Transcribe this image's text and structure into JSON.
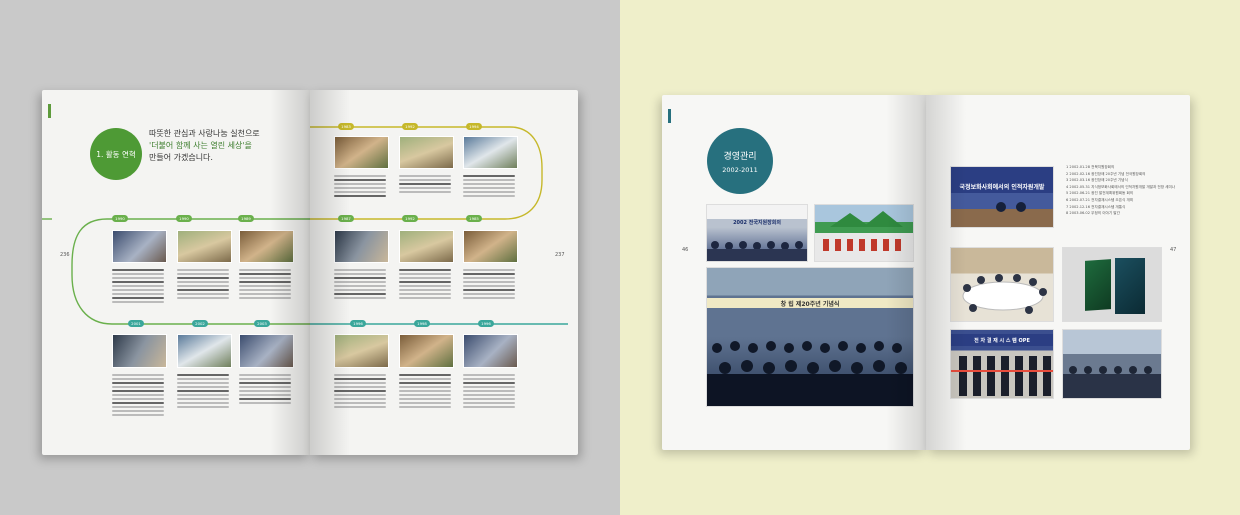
{
  "left_spread": {
    "section_badge": "1. 활동 연혁",
    "headline_line1": "따뜻한 관심과 사랑나눔 실천으로",
    "headline_line2": "'더불어 함께 사는 열린 세상'을",
    "headline_line3": "만들어 가겠습니다.",
    "page_left": "236",
    "page_right": "237",
    "year_markers_top": [
      "1983",
      "1992",
      "1994"
    ],
    "year_markers_mid": [
      "1990",
      "1990",
      "1989",
      "1987",
      "1992",
      "1985"
    ],
    "year_markers_bottom": [
      "2001",
      "2002",
      "2003",
      "1996",
      "1998",
      "1996"
    ]
  },
  "right_spread": {
    "section_title": "경영관리",
    "section_years": "2002-2011",
    "page_left": "46",
    "page_right": "47",
    "photo_banners": {
      "meeting_room": "2002 전국지원장회의",
      "conference_hall": "창 립 제20주년 기념식",
      "hrd_banner": "국정보화사회에서의 인적자원개발",
      "system_banner": "전 자 결 재 시 스 템  OPE"
    },
    "timeline_items": [
      "1  2002.01.28 전북지원장회의",
      "2  2002.02.16 광진장애 20주년 기념 전국원장회의",
      "3  2002.03.16 광진장애 20주년 기념식",
      "4  2002.05.31 지식정보화사회에서의 인적자원개발 개발과 전망 세미나",
      "5  2002.06.21 광진 발전계획위원회동 회의",
      "6  2002.07.21 전자결재시스템 오픈식 개최",
      "7  2002.12.16 전자결재시스템 개통식",
      "8  2003.06.02 우정의 이야기 발간"
    ]
  }
}
